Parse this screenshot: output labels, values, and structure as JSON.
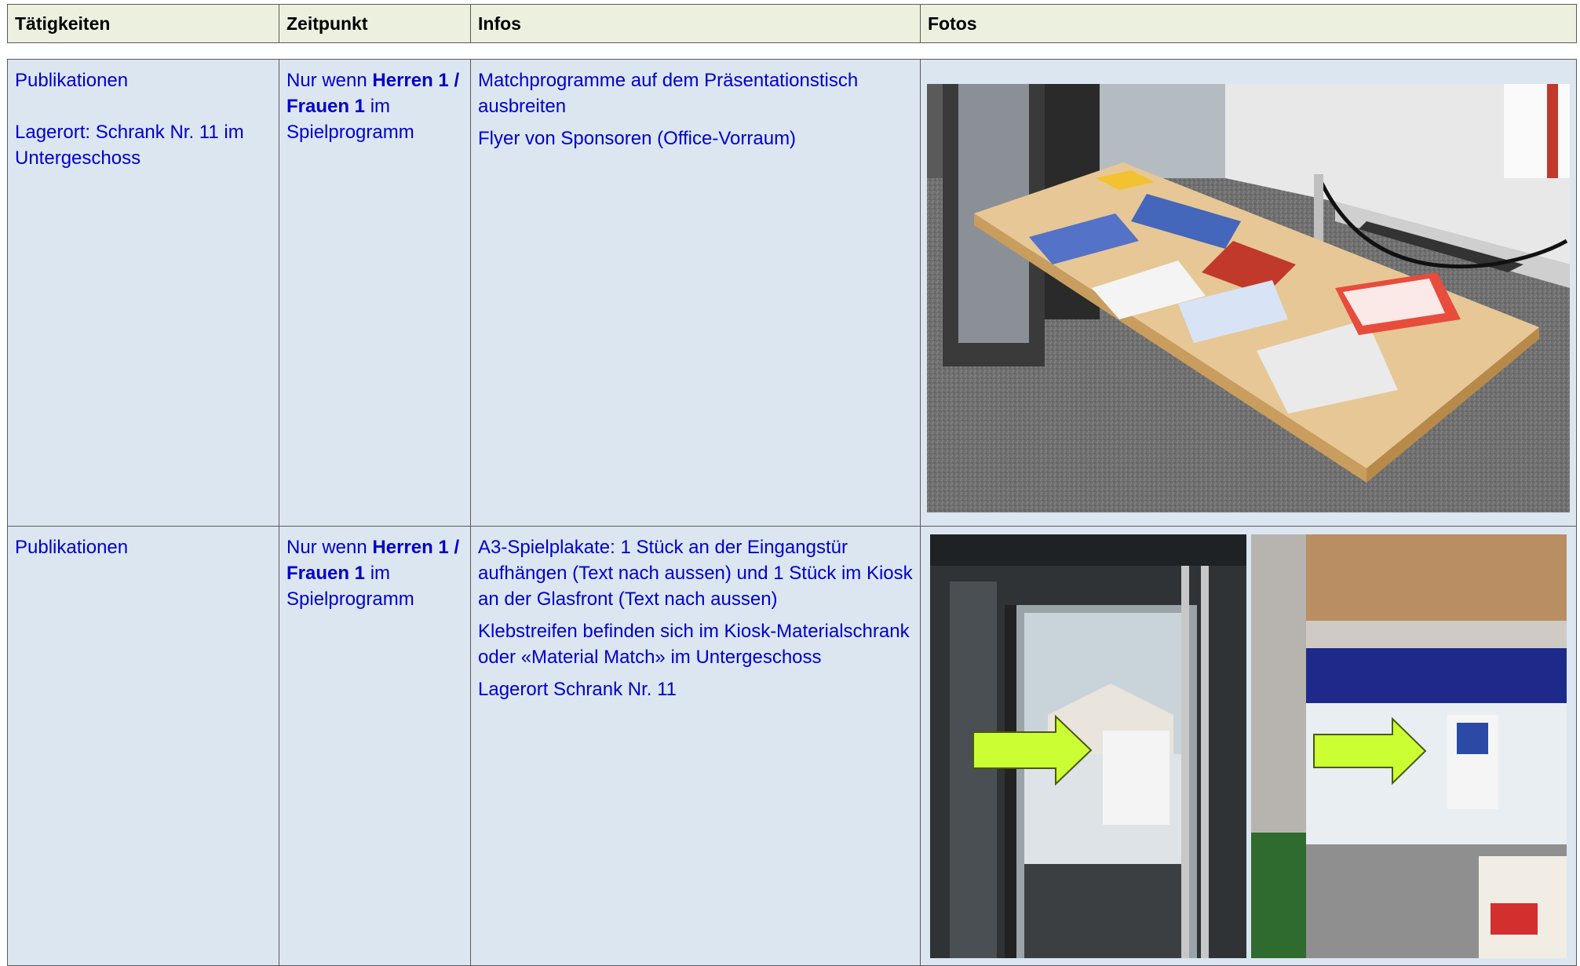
{
  "headers": [
    "Tätigkeiten",
    "Zeitpunkt",
    "Infos",
    "Fotos"
  ],
  "rows": [
    {
      "activity": "Publikationen",
      "location": "Lagerort: Schrank Nr. 11 im Untergeschoss",
      "timing": {
        "pre": "Nur wenn ",
        "bold1": "Herren 1 /",
        "bold2": "Frauen 1",
        "post": " im Spielprogramm"
      },
      "infos": [
        "Matchprogramme auf dem Präsentationstisch ausbreiten",
        "Flyer von Sponsoren (Office-Vorraum)"
      ],
      "photo_desc": "presentation-table-photo"
    },
    {
      "activity": "Publikationen",
      "timing": {
        "pre": "Nur wenn ",
        "bold1": "Herren 1 /",
        "bold2": "Frauen 1",
        "post": " im Spielprogramm"
      },
      "infos": [
        "A3-Spielplakate: 1 Stück an der Eingangstür aufhängen (Text nach aussen) und 1 Stück im Kiosk an der Glasfront (Text nach aussen)",
        "Klebstreifen befinden sich im Kiosk-Materialschrank oder «Material Match»  im Untergeschoss",
        "Lagerort Schrank Nr. 11"
      ]
    }
  ],
  "colors": {
    "header_bg": "#ebf1de",
    "row_bg": "#dce6f1",
    "text_blue": "#0000cc",
    "arrow": "#ccff33"
  }
}
